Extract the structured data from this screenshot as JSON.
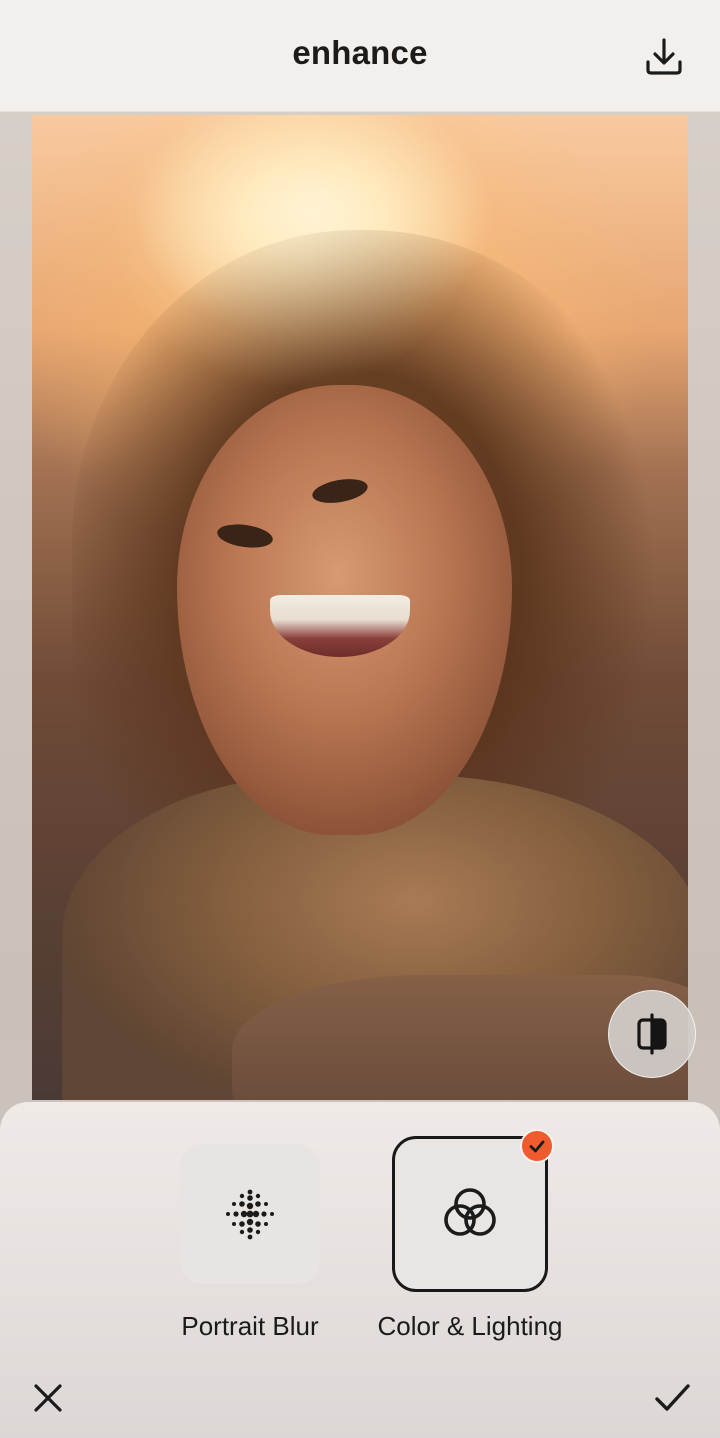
{
  "header": {
    "title": "enhance",
    "download_icon": "download-icon"
  },
  "canvas": {
    "compare_icon": "compare-split-icon"
  },
  "tools": [
    {
      "label": "Portrait Blur",
      "icon": "dot-grid-icon",
      "selected": false
    },
    {
      "label": "Color & Lighting",
      "icon": "interlocking-rings-icon",
      "selected": true
    }
  ],
  "footer": {
    "cancel_icon": "close-icon",
    "confirm_icon": "checkmark-icon"
  },
  "colors": {
    "accent": "#f05a2f",
    "selected_border": "#1a1a1a",
    "text": "#1b1b1b"
  }
}
